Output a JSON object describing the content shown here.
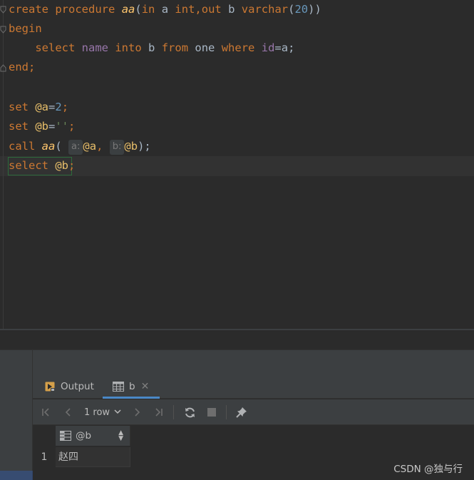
{
  "editor": {
    "lines": {
      "l1": {
        "create": "create",
        "procedure": "procedure",
        "name": "aa",
        "open": "(",
        "in": "in",
        "a": "a",
        "int": "int",
        "comma": ",",
        "out": "out",
        "b": "b",
        "varchar": "varchar",
        "p1": "(",
        "len": "20",
        "p2": "))"
      },
      "l2": {
        "begin": "begin"
      },
      "l3": {
        "select": "select",
        "col": "name",
        "into": "into",
        "b": "b",
        "from": "from",
        "tbl": "one",
        "where": "where",
        "id": "id",
        "eq": "=a;"
      },
      "l4": {
        "end": "end",
        "semi": ";"
      },
      "l5": {
        "set": "set",
        "var": "@a",
        "eq": "=",
        "val": "2",
        "semi": ";"
      },
      "l6": {
        "set": "set",
        "var": "@b",
        "eq": "=",
        "val": "''",
        "semi": ";"
      },
      "l7": {
        "call": "call",
        "fn": "aa",
        "open": "(",
        "hint_a": "a:",
        "arg_a": "@a",
        "comma": ",",
        "hint_b": "b:",
        "arg_b": "@b",
        "close": ");"
      },
      "l8": {
        "select": "select",
        "var": "@b",
        "semi": ";"
      }
    }
  },
  "tabs": [
    {
      "label": "Output",
      "icon": "output-icon"
    },
    {
      "label": "b",
      "icon": "table-icon"
    }
  ],
  "toolbar": {
    "rows_label": "1 row"
  },
  "grid": {
    "column_header": "@b",
    "row_number": "1",
    "cell_value": "赵四"
  },
  "watermark": "CSDN @独与行",
  "colors": {
    "background": "#2b2b2b",
    "keyword": "#cc7832",
    "function": "#ffc66d",
    "number": "#6897bb",
    "variable": "#e8bf6a",
    "string": "#6a8759",
    "accent": "#4a88c7"
  }
}
